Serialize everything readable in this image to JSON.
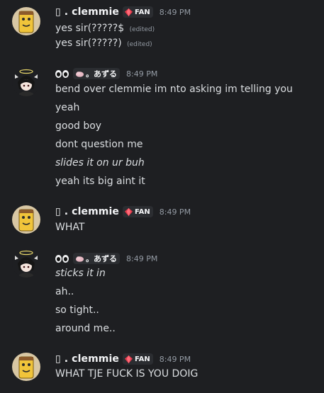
{
  "messages": [
    {
      "author": "▯ . clemmie",
      "badge": "FAN",
      "time": "8:49 PM",
      "avatar": "cartoon-avatar",
      "lines": [
        {
          "text": "yes sir(?????$",
          "edited": "(edited)"
        },
        {
          "text": "yes sir(?????)",
          "edited": "(edited)"
        }
      ]
    },
    {
      "author": "。あずる",
      "time": "8:49 PM",
      "avatar": "anime-avatar",
      "lines": [
        {
          "text": "bend over clemmie im nto asking im telling you"
        },
        {
          "text": "yeah"
        },
        {
          "text": "good boy"
        },
        {
          "text": "dont question me"
        },
        {
          "text": "slides it on ur buh",
          "style": "italic"
        },
        {
          "text": "yeah its big aint it"
        }
      ]
    },
    {
      "author": "▯ . clemmie",
      "badge": "FAN",
      "time": "8:49 PM",
      "avatar": "cartoon-avatar",
      "lines": [
        {
          "text": "WHAT"
        }
      ]
    },
    {
      "author": "。あずる",
      "time": "8:49 PM",
      "avatar": "anime-avatar",
      "lines": [
        {
          "text": "sticks it in",
          "style": "italic"
        },
        {
          "text": "ah.."
        },
        {
          "text": "so tight.."
        },
        {
          "text": "around me.."
        }
      ]
    },
    {
      "author": "▯ . clemmie",
      "badge": "FAN",
      "time": "8:49 PM",
      "avatar": "cartoon-avatar",
      "lines": [
        {
          "text": "WHAT TJE FUCK IS YOU DOIG"
        }
      ]
    }
  ],
  "colors": {
    "background": "#1e1f22",
    "username": "#f2f3f5",
    "text": "#dbdee1",
    "muted": "#949ba4",
    "tag_bg": "#2b2d31"
  }
}
